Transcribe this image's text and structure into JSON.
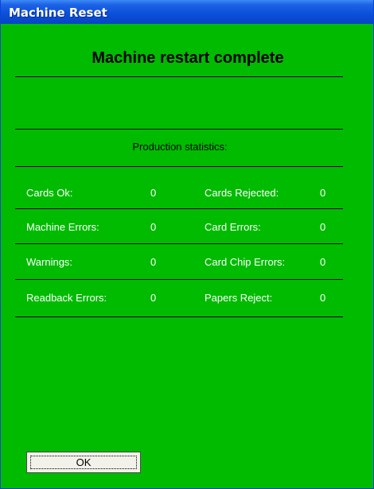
{
  "window": {
    "title": "Machine Reset"
  },
  "heading": "Machine restart complete",
  "stats": {
    "title": "Production statistics:",
    "rows": [
      {
        "left_label": "Cards Ok:",
        "left_value": "0",
        "right_label": "Cards Rejected:",
        "right_value": "0"
      },
      {
        "left_label": "Machine Errors:",
        "left_value": "0",
        "right_label": "Card Errors:",
        "right_value": "0"
      },
      {
        "left_label": "Warnings:",
        "left_value": "0",
        "right_label": "Card Chip Errors:",
        "right_value": "0"
      },
      {
        "left_label": "Readback Errors:",
        "left_value": "0",
        "right_label": "Papers Reject:",
        "right_value": "0"
      }
    ]
  },
  "buttons": {
    "ok_label": "OK"
  },
  "colors": {
    "background": "#00bb00",
    "titlebar": "#0a4fd9",
    "text_light": "#ffffff"
  }
}
